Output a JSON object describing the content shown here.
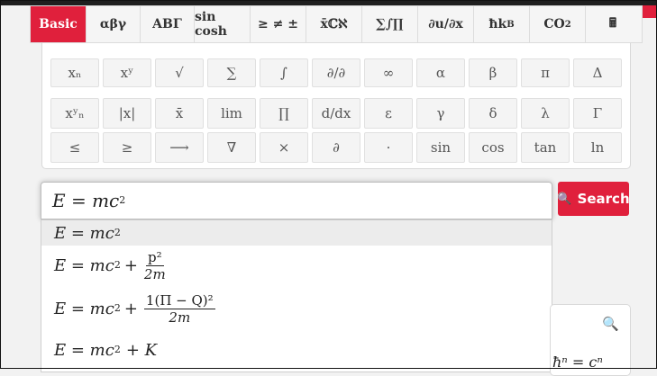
{
  "tabs": [
    {
      "label": "Basic",
      "active": true,
      "width": 62
    },
    {
      "label": "αβγ",
      "width": 60
    },
    {
      "label": "ΑΒΓ",
      "width": 60
    },
    {
      "label": "sin cosh",
      "width": 62
    },
    {
      "label": "≥ ≠ ±",
      "width": 62
    },
    {
      "label": "x̄ℂℵ",
      "width": 62
    },
    {
      "label": "∑∫∏",
      "width": 62
    },
    {
      "label": "∂u/∂x",
      "width": 62
    },
    {
      "label": "ħk",
      "sub": "B",
      "width": 62
    },
    {
      "label": "CO",
      "sub": "2",
      "width": 62
    },
    {
      "label": "🖩",
      "width": 60
    }
  ],
  "keys_row1": [
    "xₙ",
    "xʸ",
    "√",
    "∑",
    "∫",
    "∂/∂",
    "∞",
    "α",
    "β",
    "π",
    "Δ"
  ],
  "keys_row2": [
    "xʸₙ",
    "|x|",
    "x̄",
    "lim",
    "∏",
    "d/dx",
    "ε",
    "γ",
    "δ",
    "λ",
    "Γ"
  ],
  "keys_row3": [
    "≤",
    "≥",
    "⟶",
    "∇",
    "×",
    "∂",
    "·",
    "sin",
    "cos",
    "tan",
    "ln"
  ],
  "search": {
    "value": "E = mc",
    "exp": "2"
  },
  "search_button": {
    "label": "Search"
  },
  "suggestions": [
    {
      "base": "E = mc",
      "exp": "2"
    },
    {
      "base": "E = mc",
      "exp": "2",
      "plus_frac_num": "p²",
      "plus_frac_den": "2m"
    },
    {
      "base": "E = mc",
      "exp": "2",
      "plus_frac_num": "1(Π − Q)²",
      "plus_frac_den": "2m"
    },
    {
      "base": "E = mc",
      "exp": "2",
      "plus": "+ K"
    }
  ],
  "right_card_fragment": "ħⁿ = cⁿ"
}
